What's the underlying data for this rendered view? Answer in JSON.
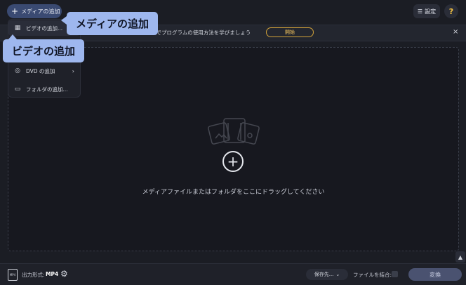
{
  "header": {
    "add_media_label": "メディアの追加",
    "settings_label": "設定",
    "help_label": "?"
  },
  "banner": {
    "text": "順でプログラムの使用方法を学びましょう",
    "start_label": "開始",
    "close_label": "×"
  },
  "menu": {
    "items": [
      {
        "label": "ビデオの追加..."
      },
      {
        "label": "DVD の追加",
        "arrow": "›"
      },
      {
        "label": "フォルダの追加..."
      }
    ]
  },
  "callouts": {
    "media": "メディアの追加",
    "video": "ビデオの追加"
  },
  "dropzone": {
    "hint": "メディアファイルまたはフォルダをここにドラッグしてください"
  },
  "footer": {
    "format_icon_text": "MP4",
    "format_label": "出力形式:",
    "format_value": "MP4",
    "save_label": "保存先...",
    "merge_label": "ファイルを結合:",
    "convert_label": "変換"
  },
  "colors": {
    "accent_blue": "#3a4a72",
    "callout": "#9eb7ee",
    "banner_button": "#d3a33a",
    "help_icon": "#f5c342"
  }
}
